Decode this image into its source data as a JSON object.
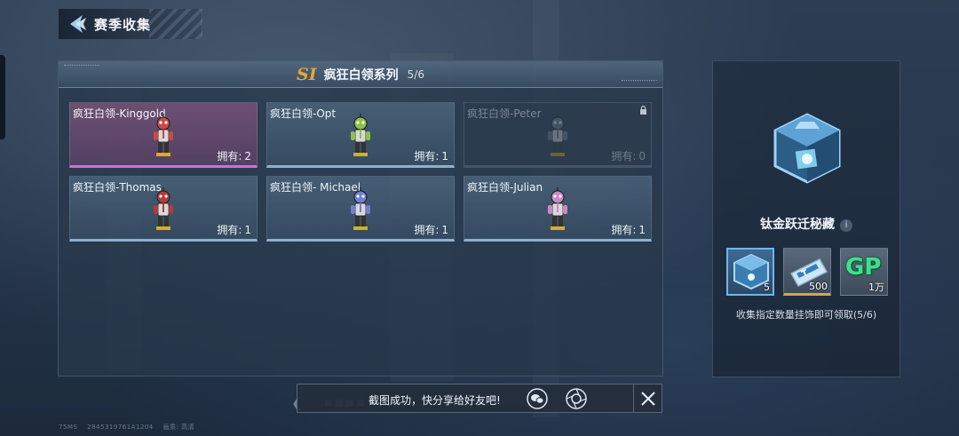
{
  "header": {
    "title": "赛季收集"
  },
  "collection": {
    "season_badge": "SI",
    "series_title": "疯狂白领系列",
    "progress_text": "5/6",
    "owned_label": "拥有:",
    "cards": [
      {
        "name": "疯狂白领-Kinggold",
        "owned": "2",
        "state": "selected",
        "color": "#c74b44"
      },
      {
        "name": "疯狂白领-Opt",
        "owned": "1",
        "state": "owned",
        "color": "#8ec248"
      },
      {
        "name": "疯狂白领-Peter",
        "owned": "0",
        "state": "locked",
        "color": "#6f7f88"
      },
      {
        "name": "疯狂白领-Thomas",
        "owned": "1",
        "state": "owned",
        "color": "#b23a3a"
      },
      {
        "name": "疯狂白领- Michael",
        "owned": "1",
        "state": "owned",
        "color": "#7080d0"
      },
      {
        "name": "疯狂白领-Julian",
        "owned": "1",
        "state": "owned",
        "color": "#c889c8"
      }
    ]
  },
  "reward": {
    "name": "钛金跃迁秘藏",
    "info_icon": "i",
    "items": [
      {
        "icon": "titanium-box-icon",
        "qty": "5"
      },
      {
        "icon": "ticket-card-icon",
        "qty": "500"
      },
      {
        "icon": "gp-currency-icon",
        "label": "GP",
        "qty": "1万"
      }
    ],
    "description": "收集指定数量挂饰即可领取(5/6)"
  },
  "share_bar": {
    "text": "截图成功，快分享给好友吧!"
  },
  "footer": {
    "fps": "75MS",
    "user_id": "2845319761A1204",
    "quality": "画质: 高清"
  },
  "colors": {
    "accent_pink": "#d46fd0",
    "accent_gold": "#e2a63a",
    "accent_blue": "#6fb6ea"
  }
}
